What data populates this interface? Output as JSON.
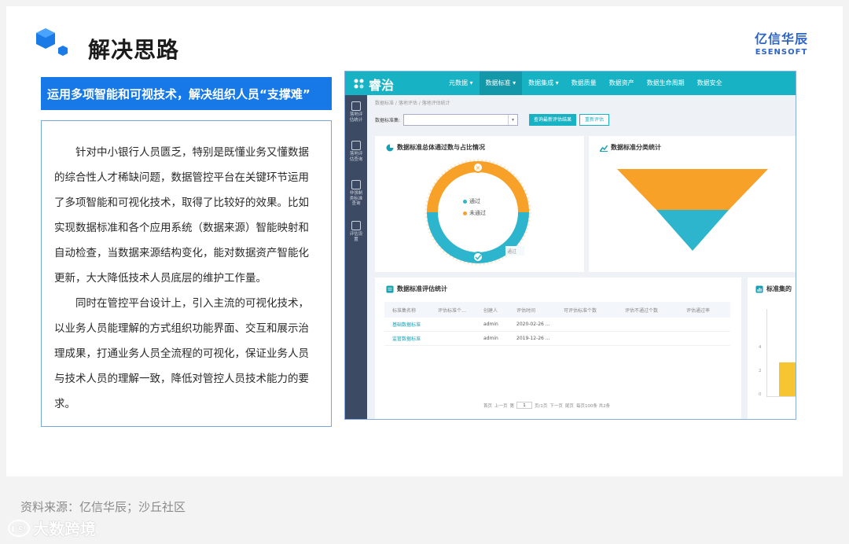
{
  "slide": {
    "title": "解决思路",
    "brand_cn": "亿信华辰",
    "brand_en": "ESENSOFT",
    "banner": "运用多项智能和可视技术，解决组织人员“支撑难”",
    "paragraphs": [
      "针对中小银行人员匮乏，特别是既懂业务又懂数据的综合性人才稀缺问题，数据管控平台在关键环节运用了多项智能和可视化技术，取得了比较好的效果。比如实现数据标准和各个应用系统（数据来源）智能映射和自动检查，当数据来源结构变化，能对数据资产智能化更新，大大降低技术人员底层的维护工作量。",
      "同时在管控平台设计上，引入主流的可视化技术，以业务人员能理解的方式组织功能界面、交互和展示治理成果，打通业务人员全流程的可视化，保证业务人员与技术人员的理解一致，降低对管控人员技术能力的要求。"
    ],
    "source": "资料来源：亿信华辰；沙丘社区",
    "watermark": "大数跨境",
    "watermark_icon": "i©"
  },
  "colors": {
    "accent": "#1778e8",
    "teal": "#17b3c5",
    "orange": "#f7a128",
    "cyan": "#2cb5cc",
    "sidebar": "#3d4a63"
  },
  "app": {
    "logo": "睿治",
    "nav": [
      {
        "label": "元数据 ▾",
        "active": false
      },
      {
        "label": "数据标准 ▾",
        "active": true
      },
      {
        "label": "数据集成 ▾",
        "active": false
      },
      {
        "label": "数据质量",
        "active": false
      },
      {
        "label": "数据资产",
        "active": false
      },
      {
        "label": "数据生命周期",
        "active": false
      },
      {
        "label": "数据安全",
        "active": false
      }
    ],
    "sidebar": [
      {
        "label": "落地评估统计",
        "icon": "report-icon"
      },
      {
        "label": "落地评估查询",
        "icon": "search-doc-icon"
      },
      {
        "label": "非强制类标准查询",
        "icon": "chart-doc-icon"
      },
      {
        "label": "评估设置",
        "icon": "settings-doc-icon"
      }
    ],
    "breadcrumb": "数据标准  /  落地评估  /  落地评估统计",
    "filter_label": "数据标准集:",
    "filter_value": "",
    "btn_latest": "查询最新评估结果",
    "btn_reassess": "重新评估",
    "donut_card_title": "数据标准总体通过数与占比情况",
    "donut_legend": [
      "通过",
      "未通过"
    ],
    "donut_label": "通过",
    "funnel_card_title": "数据标准分类统计",
    "table_card_title": "数据标准评估统计",
    "table_headers": [
      "标准集名称",
      "评估标准个…",
      "创建人",
      "评估时间",
      "可评估标准个数",
      "评估不通过个数",
      "评估通过率"
    ],
    "table_rows": [
      {
        "name": "基础数据标准",
        "count": "",
        "creator": "admin",
        "time": "2020-02-26 …",
        "a": "",
        "b": "",
        "c": ""
      },
      {
        "name": "监管数据标准",
        "count": "",
        "creator": "admin",
        "time": "2019-12-26 …",
        "a": "",
        "b": "",
        "c": ""
      }
    ],
    "pager": {
      "first": "首页",
      "prev": "上一页",
      "page_prefix": "第",
      "page": "1",
      "page_suffix": "页/1页",
      "next": "下一页",
      "last": "尾页",
      "summary": "每页100条 共2条"
    },
    "side_card_title": "标准集的",
    "side_axis": [
      "4",
      "2",
      "0"
    ]
  }
}
